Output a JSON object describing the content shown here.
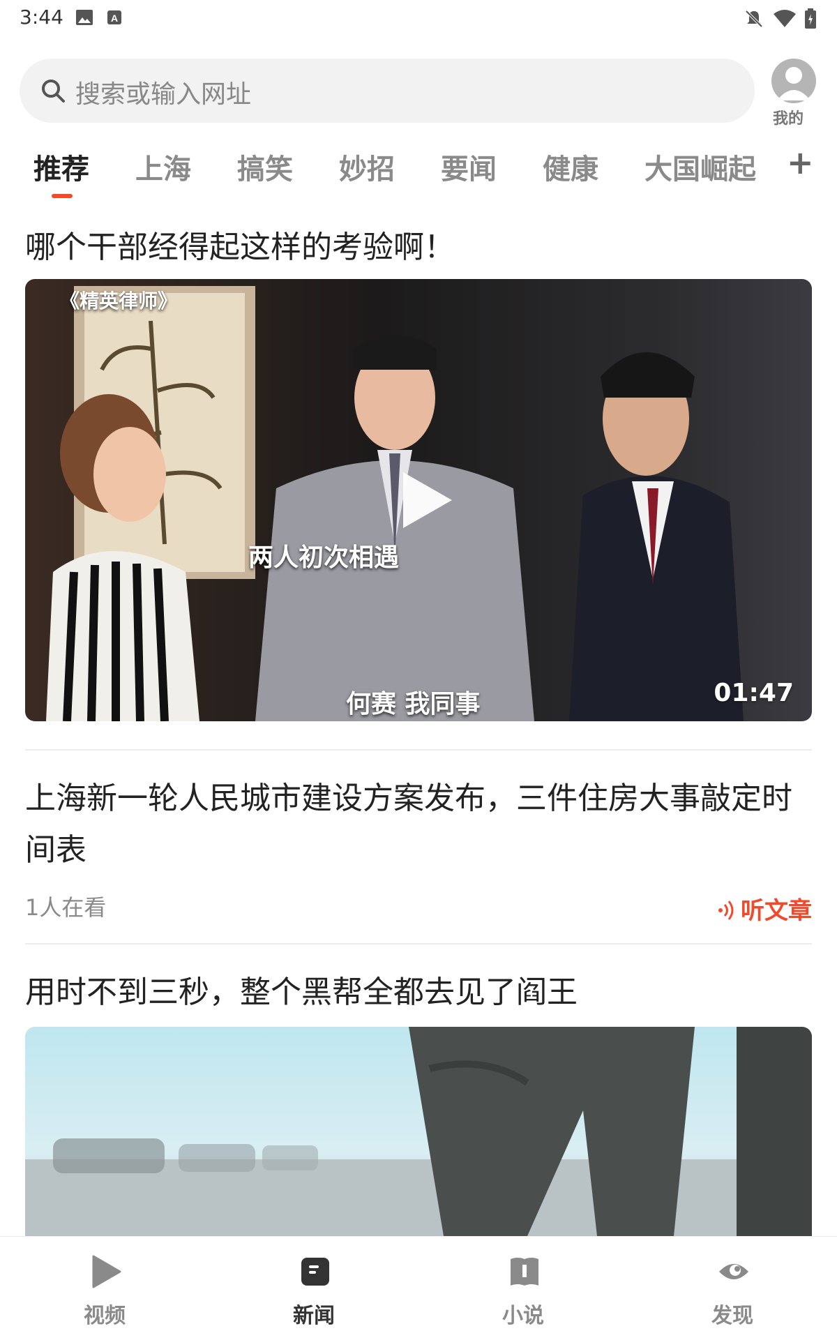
{
  "status_bar": {
    "time": "3:44"
  },
  "search": {
    "placeholder": "搜索或输入网址"
  },
  "profile": {
    "label": "我的"
  },
  "tabs": [
    {
      "label": "推荐",
      "active": true
    },
    {
      "label": "上海"
    },
    {
      "label": "搞笑"
    },
    {
      "label": "妙招"
    },
    {
      "label": "要闻"
    },
    {
      "label": "健康"
    },
    {
      "label": "大国崛起"
    }
  ],
  "add_tab": "+",
  "articles": [
    {
      "title": "哪个干部经得起这样的考验啊！",
      "video": {
        "watermark": "《精英律师》",
        "subtitle_top": "两人初次相遇",
        "subtitle_bottom": "何赛 我同事",
        "duration": "01:47"
      }
    },
    {
      "title": "上海新一轮人民城市建设方案发布，三件住房大事敲定时间表",
      "meta": "1人在看",
      "listen_label": "听文章"
    },
    {
      "title": "用时不到三秒，整个黑帮全都去见了阎王"
    }
  ],
  "bottom_nav": [
    {
      "label": "视频",
      "icon": "play-icon"
    },
    {
      "label": "新闻",
      "icon": "news-icon",
      "active": true
    },
    {
      "label": "小说",
      "icon": "book-icon"
    },
    {
      "label": "发现",
      "icon": "eye-icon"
    }
  ],
  "colors": {
    "accent": "#f04a2a",
    "text": "#222222",
    "muted": "#8a8a8a"
  }
}
